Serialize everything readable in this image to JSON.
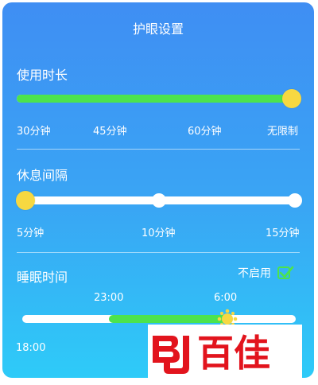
{
  "header": {
    "title": "护眼设置"
  },
  "usage": {
    "label": "使用时长",
    "ticks": [
      "30分钟",
      "45分钟",
      "60分钟",
      "无限制"
    ],
    "selected": "无限制"
  },
  "rest": {
    "label": "休息间隔",
    "ticks": [
      "5分钟",
      "10分钟",
      "15分钟"
    ],
    "selected": "5分钟"
  },
  "sleep": {
    "label": "睡眠时间",
    "toggle_label": "不启用",
    "toggle_checked": true,
    "start_time": "23:00",
    "end_time": "6:00",
    "axis_start": "18:00"
  },
  "watermark": {
    "brand": "百佳",
    "logo_letters": "BJ"
  },
  "colors": {
    "accent_green": "#4ce34d",
    "knob_yellow": "#f7d841",
    "watermark_red": "#e2141d"
  }
}
